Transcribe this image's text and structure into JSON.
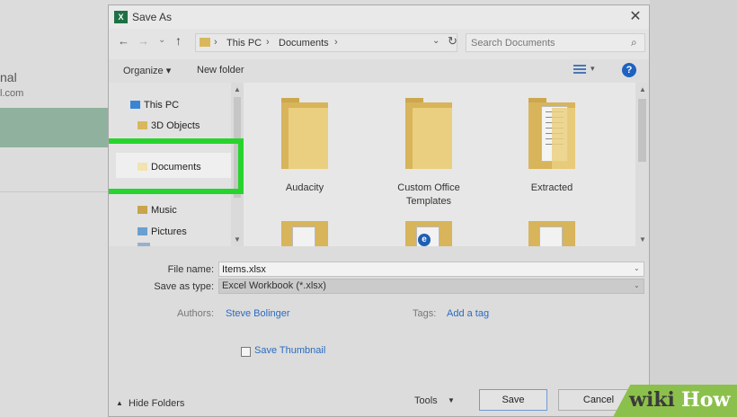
{
  "background_app": {
    "partial_title": "nal",
    "partial_email": "l.com"
  },
  "dialog": {
    "title": "Save As",
    "app_icon_letter": "X",
    "close": "✕",
    "nav": {
      "back": "←",
      "forward": "→",
      "recent": "⌄",
      "up": "↑",
      "refresh": "↻",
      "dropdown": "⌄"
    },
    "address": {
      "separators": [
        "›",
        "›",
        "›"
      ],
      "path": [
        "This PC",
        "Documents"
      ]
    },
    "search": {
      "placeholder": "Search Documents",
      "icon": "⌕"
    },
    "toolbar": {
      "organize": "Organize ▾",
      "new_folder": "New folder",
      "view_dropdown": "▾",
      "help": "?"
    },
    "sidebar": {
      "scroll_up": "▲",
      "scroll_down": "▼",
      "items": [
        {
          "label": "This PC",
          "icon": "computer-icon"
        },
        {
          "label": "3D Objects",
          "icon": "cube-icon"
        },
        {
          "label": "Documents",
          "icon": "documents-icon"
        },
        {
          "label": "Music",
          "icon": "music-icon"
        },
        {
          "label": "Pictures",
          "icon": "pictures-icon"
        }
      ]
    },
    "content": {
      "scroll_up": "▲",
      "scroll_down": "▼",
      "folders": [
        {
          "name": "Audacity"
        },
        {
          "name": "Custom Office\nTemplates"
        },
        {
          "name": "Extracted"
        }
      ],
      "edge_badge": "e"
    },
    "form": {
      "file_name_label": "File name:",
      "file_name": "Items.xlsx",
      "save_type_label": "Save as type:",
      "save_type": "Excel Workbook (*.xlsx)",
      "dropdown": "⌄",
      "authors_label": "Authors:",
      "authors": "Steve Bolinger",
      "tags_label": "Tags:",
      "tags": "Add a tag",
      "save_thumbnail": "Save Thumbnail"
    },
    "footer": {
      "hide_arrow": "▲",
      "hide_folders": "Hide Folders",
      "tools": "Tools",
      "tools_drop": "▼",
      "save": "Save",
      "cancel": "Cancel"
    }
  },
  "watermark": {
    "wiki": "wiki",
    "how": "How"
  },
  "colors": {
    "highlight": "#27d42d",
    "excel": "#1e7145",
    "folder": "#d8b45a",
    "link": "#2a6cc0",
    "watermark": "#8cc04c"
  }
}
